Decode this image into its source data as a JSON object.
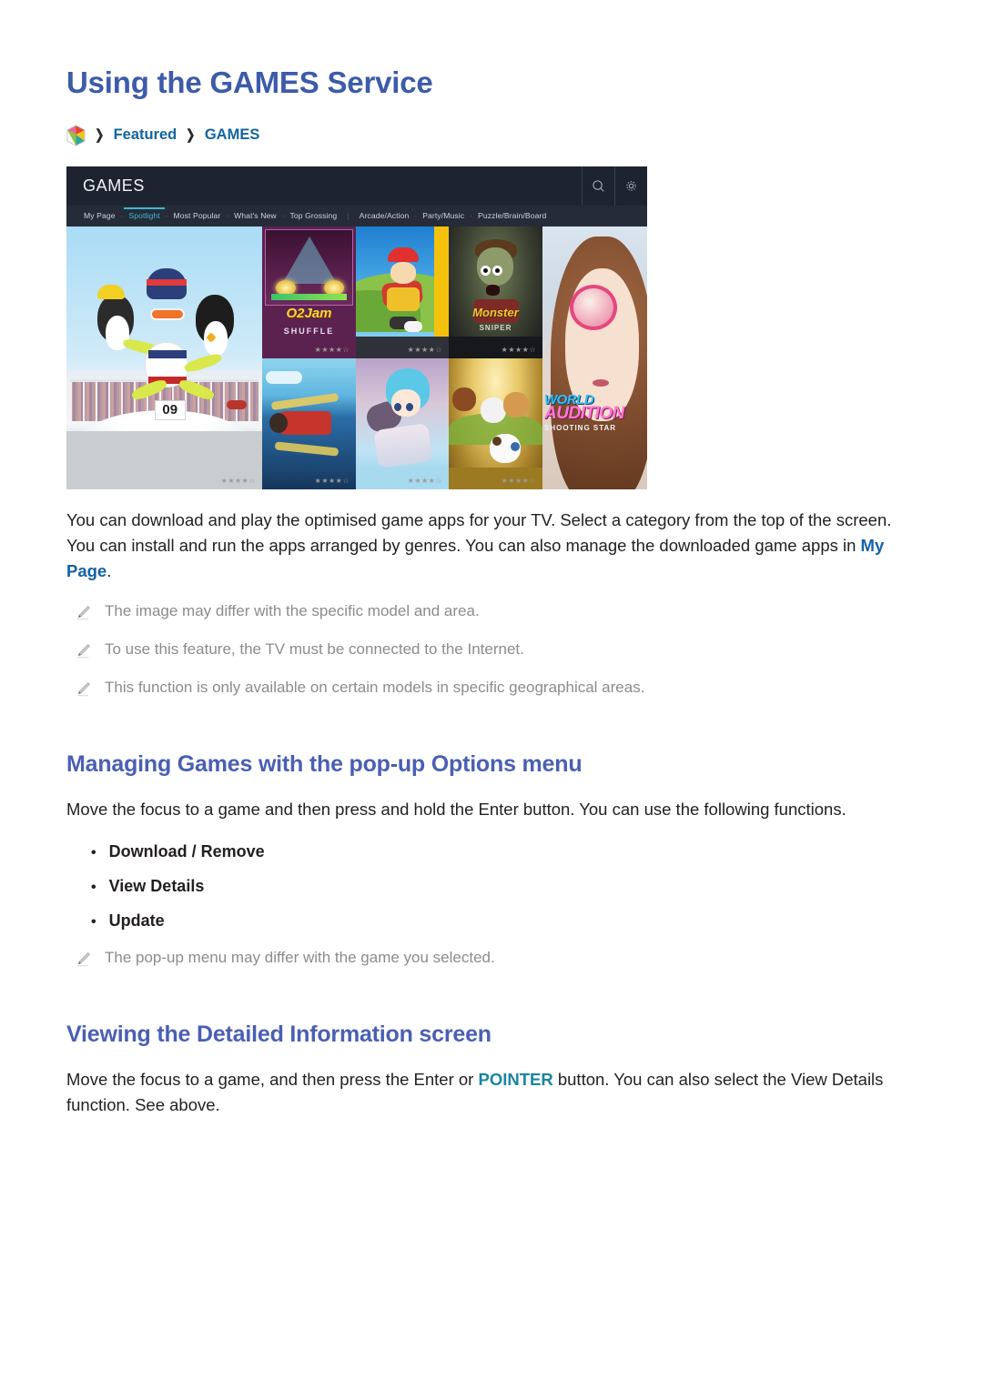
{
  "page": {
    "title": "Using the GAMES Service"
  },
  "breadcrumb": {
    "home_icon": "smart-hub-icon",
    "separator": "❯",
    "items": [
      {
        "label": "Featured"
      },
      {
        "label": "GAMES"
      }
    ]
  },
  "tv_screenshot": {
    "header": {
      "title": "GAMES",
      "search_icon": "search-icon",
      "settings_icon": "gear-icon"
    },
    "nav": {
      "items": [
        {
          "label": "My Page",
          "active": false
        },
        {
          "label": "Spotlight",
          "active": true
        },
        {
          "label": "Most Popular",
          "active": false
        },
        {
          "label": "What's New",
          "active": false
        },
        {
          "label": "Top Grossing",
          "active": false
        },
        {
          "label": "Arcade/Action",
          "active": false
        },
        {
          "label": "Party/Music",
          "active": false
        },
        {
          "label": "Puzzle/Brain/Board",
          "active": false
        }
      ],
      "dot": "·",
      "pipe": "|"
    },
    "tiles": [
      {
        "name": "curling-penguin-game",
        "rating": "★★★★☆",
        "jersey_number": "09"
      },
      {
        "name": "o2jam-shuffle",
        "title": "O2Jam",
        "subtitle": "SHUFFLE",
        "rating": "★★★★☆"
      },
      {
        "name": "boy-adventure-game",
        "rating": "★★★★☆"
      },
      {
        "name": "monster-sniper",
        "title": "Monster",
        "subtitle": "SNIPER",
        "rating": "★★★★☆"
      },
      {
        "name": "world-auditions",
        "title_a": "WORLD",
        "title_b": "AUDITION",
        "title_c": "SHOOTING STAR"
      },
      {
        "name": "biplane-shooter",
        "rating": "★★★★☆"
      },
      {
        "name": "anime-rpg",
        "rating": "★★★★☆"
      },
      {
        "name": "puppy-game",
        "rating": "★★★★☆"
      }
    ]
  },
  "intro": {
    "part1": "You can download and play the optimised game apps for your TV. Select a category from the top of the screen. You can install and run the apps arranged by genres. You can also manage the downloaded game apps in ",
    "link": "My Page",
    "part2": "."
  },
  "notes_top": [
    {
      "icon": "pencil-icon",
      "text": "The image may differ with the specific model and area."
    },
    {
      "icon": "pencil-icon",
      "text": "To use this feature, the TV must be connected to the Internet."
    },
    {
      "icon": "pencil-icon",
      "text": "This function is only available on certain models in specific geographical areas."
    }
  ],
  "section_managing": {
    "heading": "Managing Games with the pop-up Options menu",
    "paragraph": "Move the focus to a game and then press and hold the Enter button. You can use the following functions.",
    "bullets": [
      {
        "label": "Download / Remove"
      },
      {
        "label": "View Details"
      },
      {
        "label": "Update"
      }
    ],
    "note": {
      "icon": "pencil-icon",
      "text": "The pop-up menu may differ with the game you selected."
    }
  },
  "section_viewing": {
    "heading": "Viewing the Detailed Information screen",
    "para_part1": "Move the focus to a game, and then press the Enter or ",
    "para_link": "POINTER",
    "para_part2": " button. You can also select the View Details function. See above."
  },
  "colors": {
    "title_blue": "#3d5ba9",
    "heading_blue": "#4a5fb4",
    "link_blue": "#1461a8",
    "link_teal": "#1a85a0",
    "note_gray": "#8c8c8c",
    "tv_header_bg": "#1d2430",
    "tv_nav_bg": "#252c38",
    "tv_nav_active": "#3fb6d3"
  },
  "bullet_glyph": "•"
}
